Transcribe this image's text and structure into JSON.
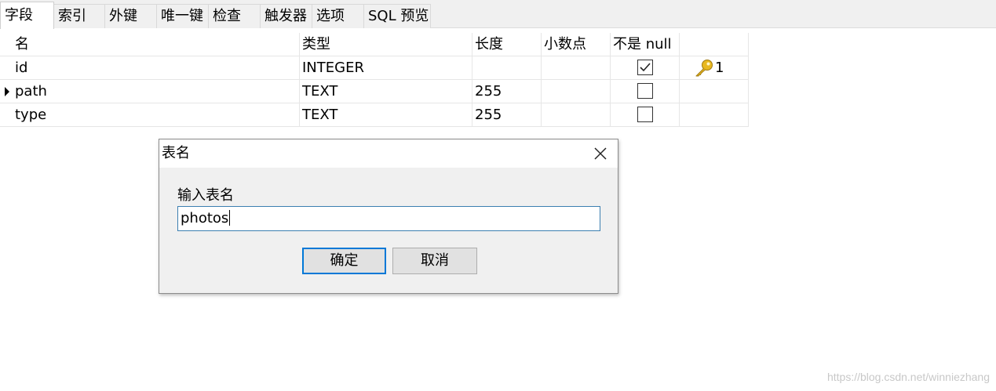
{
  "tabs": [
    {
      "label": "字段",
      "active": true
    },
    {
      "label": "索引",
      "active": false
    },
    {
      "label": "外键",
      "active": false
    },
    {
      "label": "唯一键",
      "active": false
    },
    {
      "label": "检查",
      "active": false
    },
    {
      "label": "触发器",
      "active": false
    },
    {
      "label": "选项",
      "active": false
    },
    {
      "label": "SQL 预览",
      "active": false
    }
  ],
  "grid": {
    "headers": {
      "name": "名",
      "type": "类型",
      "length": "长度",
      "decimals": "小数点",
      "not_null": "不是 null",
      "key": ""
    },
    "rows": [
      {
        "name": "id",
        "type": "INTEGER",
        "length": "",
        "decimals": "",
        "not_null": true,
        "key": "1",
        "current": false
      },
      {
        "name": "path",
        "type": "TEXT",
        "length": "255",
        "decimals": "",
        "not_null": false,
        "key": "",
        "current": true
      },
      {
        "name": "type",
        "type": "TEXT",
        "length": "255",
        "decimals": "",
        "not_null": false,
        "key": "",
        "current": false
      }
    ]
  },
  "dialog": {
    "title": "表名",
    "prompt": "输入表名",
    "input_value": "photos",
    "ok_label": "确定",
    "cancel_label": "取消"
  },
  "watermark": "https://blog.csdn.net/winniezhang",
  "colors": {
    "accent": "#0078d7",
    "input_border": "#3c7fb1",
    "key_gold": "#e8b820"
  },
  "icons": {
    "close": "close-icon",
    "key": "primary-key-icon",
    "row_pointer": "row-pointer-icon",
    "check": "check-icon"
  }
}
